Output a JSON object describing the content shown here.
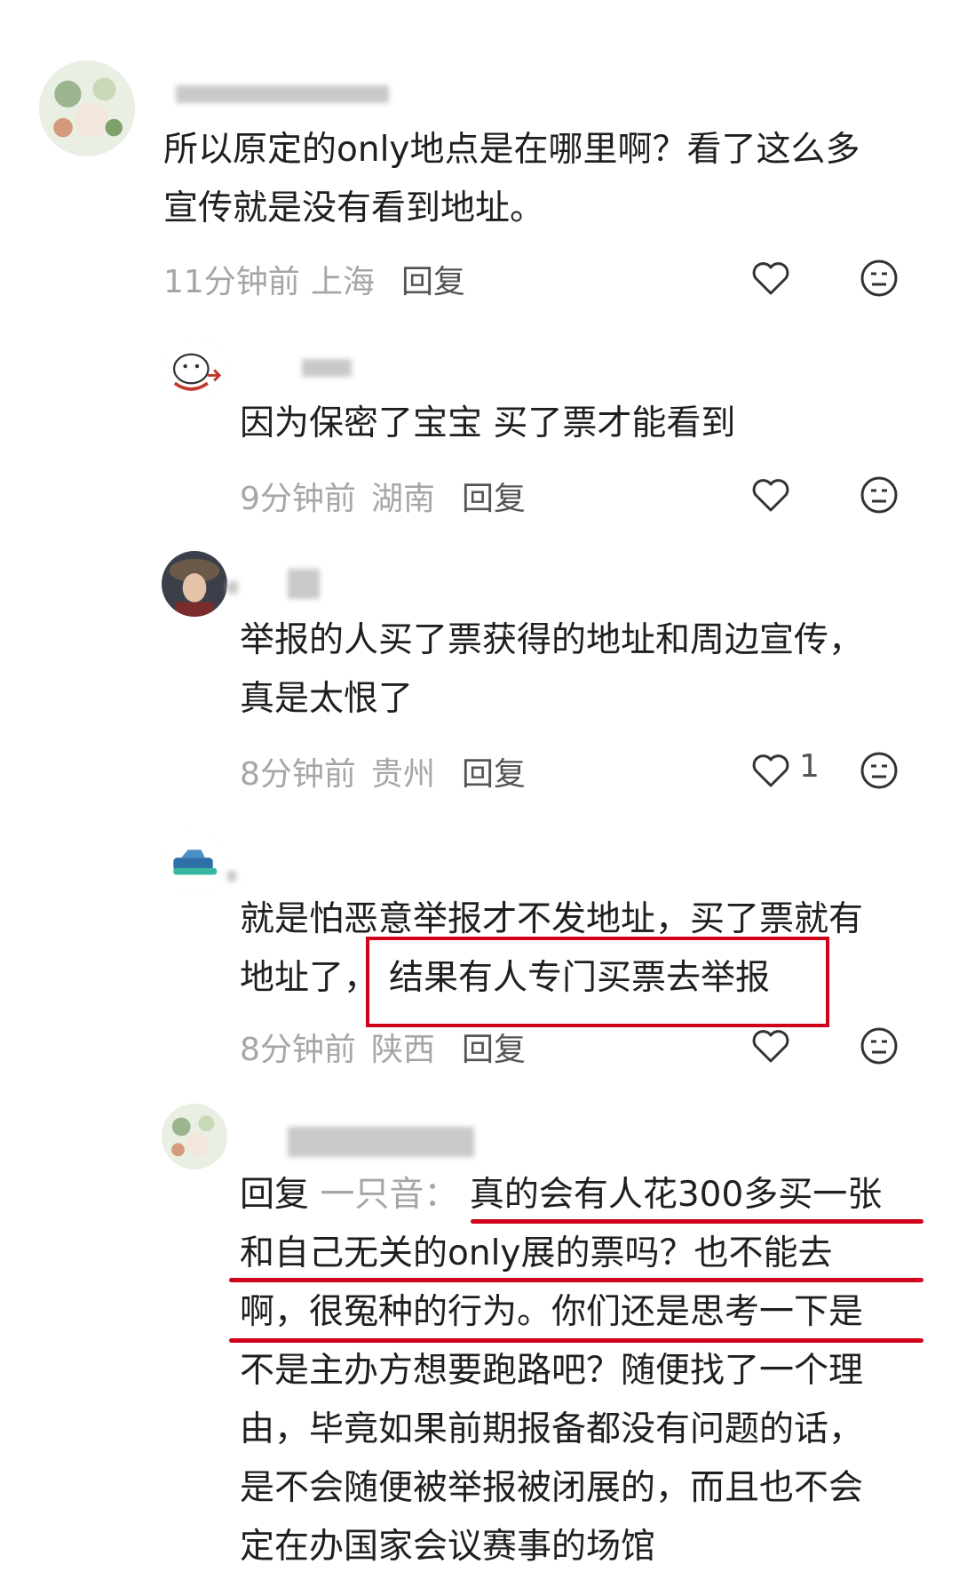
{
  "comments": [
    {
      "text_lines": [
        "所以原定的only地点是在哪里啊？看了这么多",
        "宣传就是没有看到地址。"
      ],
      "time": "11分钟前",
      "location": "上海",
      "reply_label": "回复",
      "likes": ""
    },
    {
      "text_lines": [
        "因为保密了宝宝 买了票才能看到"
      ],
      "time": "9分钟前",
      "location": "湖南",
      "reply_label": "回复",
      "likes": ""
    },
    {
      "text_lines": [
        "举报的人买了票获得的地址和周边宣传，",
        "真是太恨了"
      ],
      "time": "8分钟前",
      "location": "贵州",
      "reply_label": "回复",
      "likes": "1"
    },
    {
      "text_lines": [
        "就是怕恶意举报才不发地址，买了票就有",
        "地址了，",
        "结果有人专门买票去举报"
      ],
      "time": "8分钟前",
      "location": "陕西",
      "reply_label": "回复",
      "likes": ""
    },
    {
      "reply_prefix": "回复",
      "reply_target": "一只音：",
      "text_lines": [
        "真的会有人花300多买一张",
        "和自己无关的only展的票吗？也不能去",
        "啊，很冤种的行为。你们还是思考一下是",
        "不是主办方想要跑路吧？随便找了一个理",
        "由，毕竟如果前期报备都没有问题的话，",
        "是不会随便被举报被闭展的，而且也不会",
        "定在办国家会议赛事的场馆"
      ]
    }
  ],
  "annotation_color": "#d0021b",
  "icons": [
    "heart-outline",
    "dislike-face"
  ]
}
